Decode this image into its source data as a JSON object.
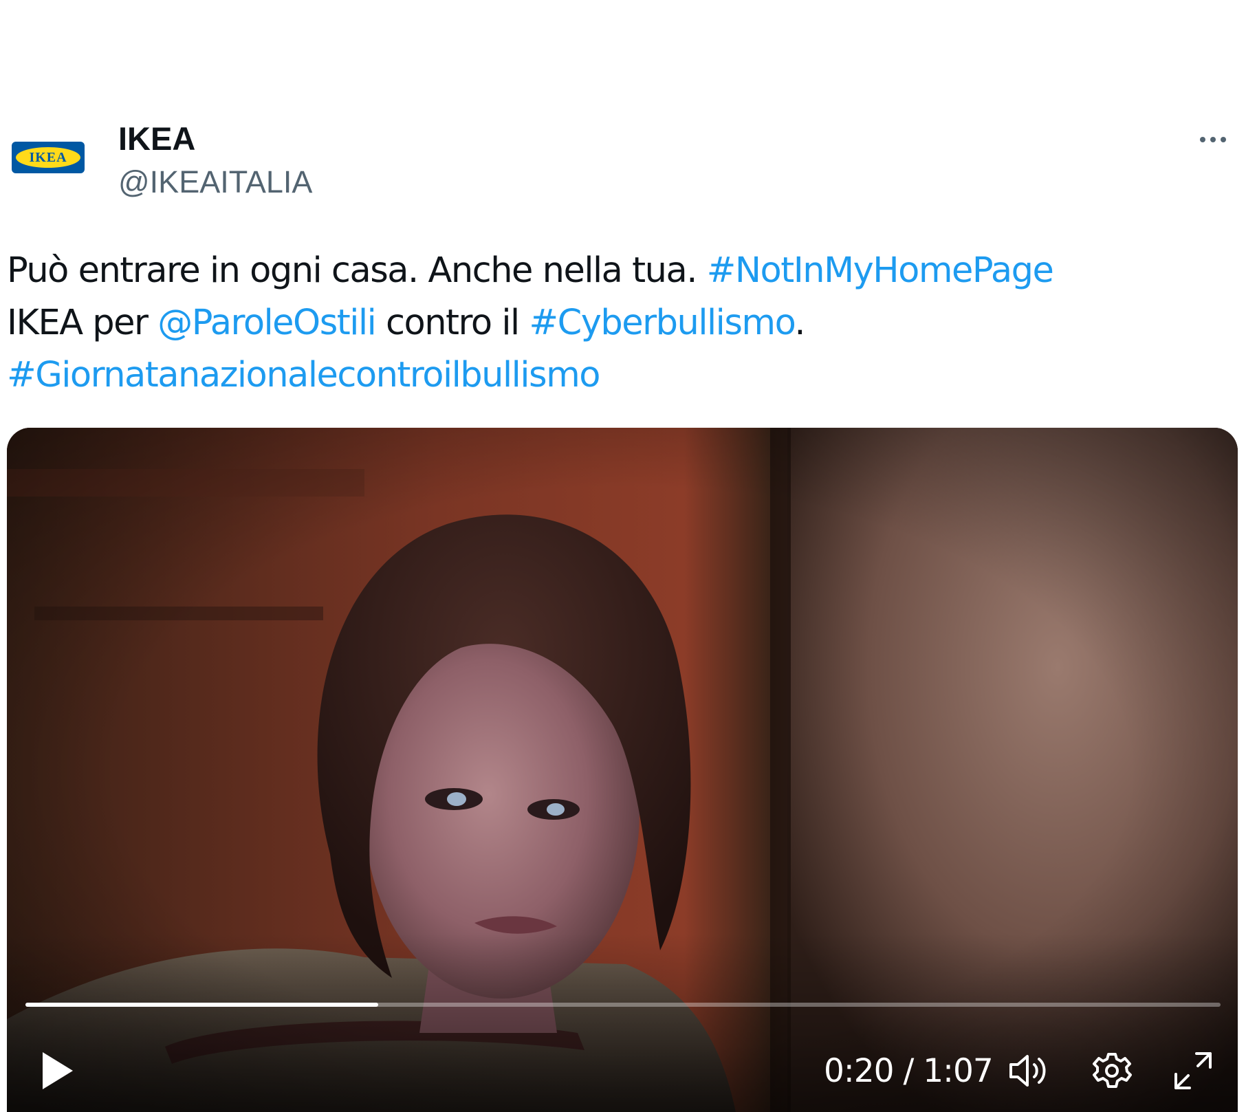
{
  "author": {
    "display_name": "IKEA",
    "handle": "@IKEAITALIA",
    "avatar_logo_text": "IKEA",
    "avatar_icon": "ikea-logo-icon"
  },
  "more_icon": "more-horizontal-icon",
  "tweet": {
    "line1_text": "Può entrare in ogni casa. Anche nella tua. ",
    "line1_hashtag": "#NotInMyHomePage",
    "line2_prefix": "IKEA per ",
    "line2_mention": "@ParoleOstili",
    "line2_middle": " contro il ",
    "line2_hashtag": "#Cyberbullismo",
    "line2_suffix": ".",
    "line3_hashtag": "#Giornatanazionalecontroilbullismo"
  },
  "video": {
    "progress_fraction": 0.295,
    "time_display": "0:20 / 1:07",
    "icons": {
      "play": "play-icon",
      "volume": "volume-icon",
      "settings": "gear-icon",
      "fullscreen": "fullscreen-icon"
    }
  },
  "colors": {
    "link": "#1d9bf0",
    "text": "#0f1419",
    "secondary_text": "#536471",
    "ikea_blue": "#0058a3",
    "ikea_yellow": "#ffda1a"
  }
}
